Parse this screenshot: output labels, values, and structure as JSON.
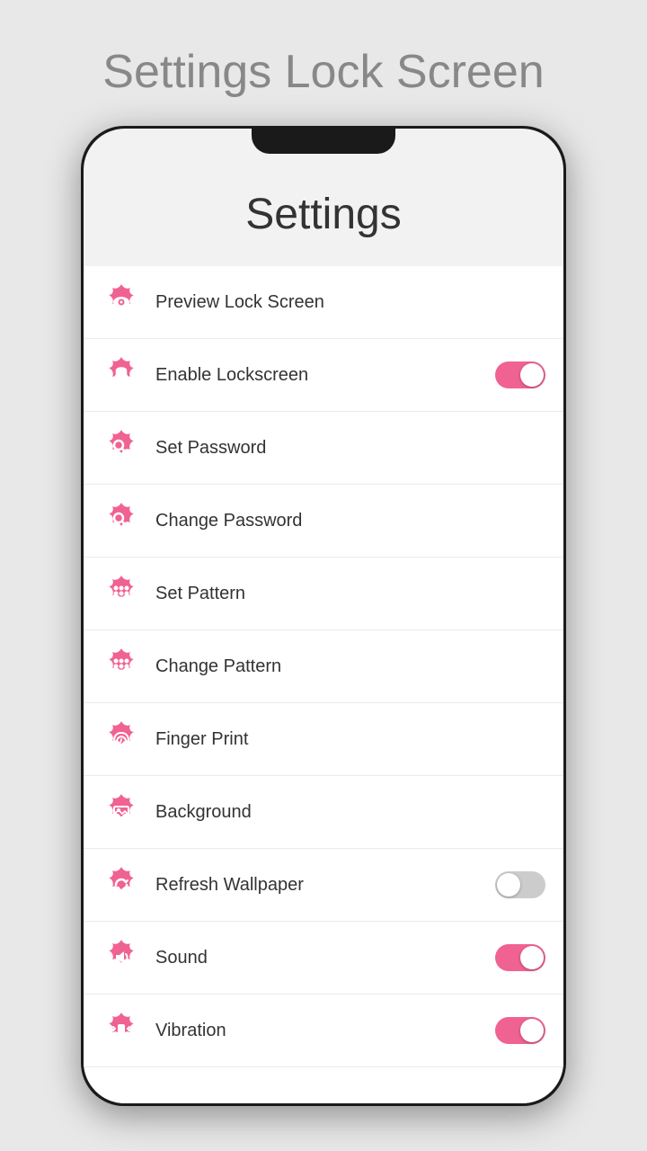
{
  "page": {
    "title": "Settings Lock Screen"
  },
  "settings": {
    "heading": "Settings",
    "items": [
      {
        "id": "preview-lock-screen",
        "label": "Preview Lock Screen",
        "icon": "eye",
        "toggle": null
      },
      {
        "id": "enable-lockscreen",
        "label": "Enable Lockscreen",
        "icon": "lock",
        "toggle": "on"
      },
      {
        "id": "set-password",
        "label": "Set Password",
        "icon": "key",
        "toggle": null
      },
      {
        "id": "change-password",
        "label": "Change Password",
        "icon": "key2",
        "toggle": null
      },
      {
        "id": "set-pattern",
        "label": "Set Pattern",
        "icon": "pattern",
        "toggle": null
      },
      {
        "id": "change-pattern",
        "label": "Change Pattern",
        "icon": "pattern2",
        "toggle": null
      },
      {
        "id": "finger-print",
        "label": "Finger Print",
        "icon": "fingerprint",
        "toggle": null
      },
      {
        "id": "background",
        "label": "Background",
        "icon": "image",
        "toggle": null
      },
      {
        "id": "refresh-wallpaper",
        "label": "Refresh Wallpaper",
        "icon": "refresh",
        "toggle": "off"
      },
      {
        "id": "sound",
        "label": "Sound",
        "icon": "sound",
        "toggle": "on"
      },
      {
        "id": "vibration",
        "label": "Vibration",
        "icon": "vibration",
        "toggle": "on"
      }
    ]
  }
}
